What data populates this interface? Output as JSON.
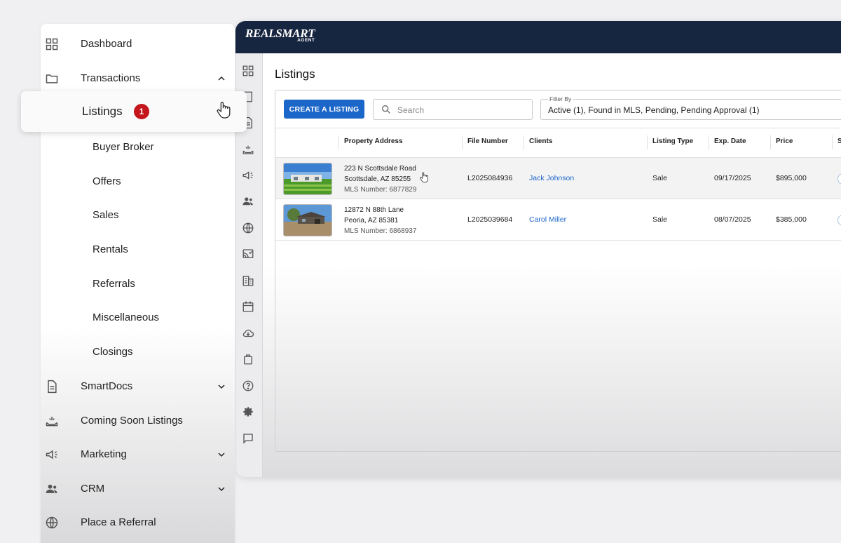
{
  "app": {
    "logo_main": "REALSMART",
    "logo_sub": "AGENT"
  },
  "rail_icons": [
    "dashboard-icon",
    "document-icon",
    "file-icon",
    "coming-soon-icon",
    "megaphone-icon",
    "people-icon",
    "globe-icon",
    "cast-icon",
    "building-icon",
    "calendar-icon",
    "cloud-download-icon",
    "bag-icon",
    "help-icon",
    "settings-icon",
    "chat-icon"
  ],
  "listings_page": {
    "title": "Listings",
    "create_button": "CREATE A LISTING",
    "search_placeholder": "Search",
    "filter_label": "Filter By",
    "filter_value": "Active (1), Found in MLS, Pending, Pending Approval (1)",
    "columns": [
      "Property Address",
      "File Number",
      "Clients",
      "Listing Type",
      "Exp. Date",
      "Price",
      "S"
    ],
    "rows": [
      {
        "address_line1": "223 N Scottsdale Road",
        "address_line2": "Scottsdale, AZ 85255",
        "mls": "MLS Number: 6877829",
        "file_number": "L2025084936",
        "client": "Jack Johnson",
        "listing_type": "Sale",
        "exp_date": "09/17/2025",
        "price": "$895,000"
      },
      {
        "address_line1": "12872 N 88th Lane",
        "address_line2": "Peoria, AZ 85381",
        "mls": "MLS Number: 6868937",
        "file_number": "L2025039684",
        "client": "Carol Miller",
        "listing_type": "Sale",
        "exp_date": "08/07/2025",
        "price": "$385,000"
      }
    ]
  },
  "sidebar": {
    "items": [
      {
        "label": "Dashboard",
        "icon": "dashboard-icon"
      },
      {
        "label": "Transactions",
        "icon": "folder-icon",
        "expanded": true
      },
      {
        "label": "SmartDocs",
        "icon": "document-icon",
        "expandable": true
      },
      {
        "label": "Coming Soon Listings",
        "icon": "coming-soon-icon"
      },
      {
        "label": "Marketing",
        "icon": "megaphone-icon",
        "expandable": true
      },
      {
        "label": "CRM",
        "icon": "people-icon",
        "expandable": true
      },
      {
        "label": "Place a Referral",
        "icon": "globe-icon"
      }
    ],
    "transactions_sub": [
      {
        "label": "Listings",
        "badge": "1",
        "active": true
      },
      {
        "label": "Buyer Broker"
      },
      {
        "label": "Offers"
      },
      {
        "label": "Sales"
      },
      {
        "label": "Rentals"
      },
      {
        "label": "Referrals"
      },
      {
        "label": "Miscellaneous"
      },
      {
        "label": "Closings"
      }
    ]
  },
  "colors": {
    "topbar": "#172640",
    "primary": "#1b66c9",
    "badge": "#c4161c"
  }
}
